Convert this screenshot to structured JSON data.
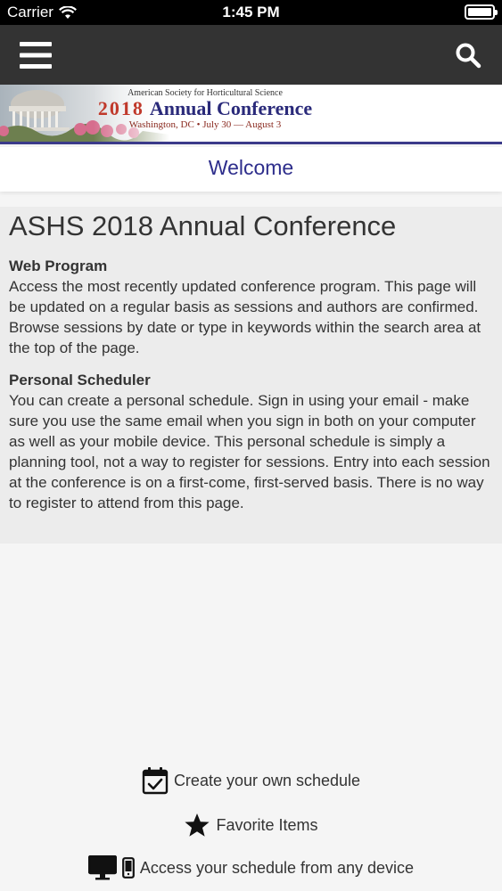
{
  "status_bar": {
    "carrier": "Carrier",
    "time": "1:45 PM"
  },
  "nav": {
    "menu_icon": "hamburger-menu-icon",
    "search_icon": "search-icon"
  },
  "banner": {
    "society": "American Society for Horticultural Science",
    "year": "2018",
    "title": "Annual Conference",
    "subtitle": "Washington, DC • July 30 — August 3"
  },
  "welcome": {
    "label": "Welcome"
  },
  "content": {
    "heading": "ASHS 2018 Annual Conference",
    "sections": [
      {
        "title": "Web Program",
        "body": "Access the most recently updated conference program. This page will be updated on a regular basis as sessions and authors are confirmed. Browse sessions by date or type in keywords within the search area at the top of the page."
      },
      {
        "title": "Personal Scheduler",
        "body": "You can create a personal schedule. Sign in using your email - make sure you use the same email when you sign in both on your computer as well as your mobile device. This personal schedule is simply a planning tool, not a way to register for sessions. Entry into each session at the conference is on a first-come, first-served basis. There is no way to register to attend from this page."
      }
    ]
  },
  "features": [
    {
      "icon": "calendar-check-icon",
      "label": "Create your own schedule"
    },
    {
      "icon": "star-icon",
      "label": "Favorite Items"
    },
    {
      "icon": "devices-icon",
      "label": "Access your schedule from any device"
    }
  ],
  "colors": {
    "navbar": "#333333",
    "accent": "#2e2e8c",
    "content_bg": "#ececec"
  }
}
